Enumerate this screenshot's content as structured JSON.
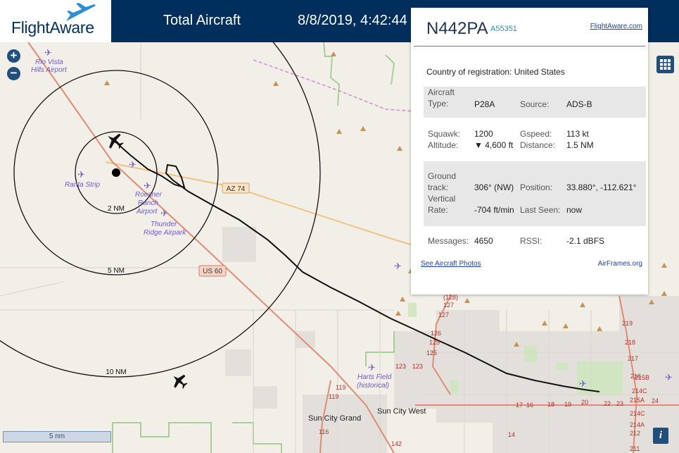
{
  "header": {
    "logo_text": "FlightAware",
    "total_label": "Total Aircraft",
    "timestamp": "8/8/2019, 4:42:44"
  },
  "map_controls": {
    "zoom_in": "+",
    "zoom_out": "−",
    "info": "i",
    "scale_label": "5 nm"
  },
  "range_rings": [
    "2 NM",
    "5 NM",
    "10 NM"
  ],
  "places": [
    "Rio Vista Hills Airport",
    "Ranta Strip",
    "Roesner Ranch Airport",
    "Thunder Ridge Airpark",
    "Harts Field (historical)",
    "Sun City West",
    "Sun City Grand"
  ],
  "roads": [
    "AZ 74",
    "US 60"
  ],
  "road_numbers": [
    "(128)",
    "127",
    "127",
    "126",
    "125",
    "125",
    "123",
    "123",
    "119",
    "119",
    "116",
    "142",
    "17",
    "16",
    "18",
    "19",
    "20",
    "22",
    "23",
    "24",
    "14",
    "219",
    "218",
    "217",
    "216",
    "215B",
    "214C",
    "215A",
    "214C",
    "214A",
    "212",
    "211"
  ],
  "panel": {
    "registration": "N442PA",
    "hex": "A55351",
    "link": "FlightAware.com",
    "country_label": "Country of registration:",
    "country_value": "United States",
    "aircraft_type_label": "Aircraft Type:",
    "aircraft_type_value": "P28A",
    "source_label": "Source:",
    "source_value": "ADS-B",
    "squawk_label": "Squawk:",
    "squawk_value": "1200",
    "gspeed_label": "Gspeed:",
    "gspeed_value": "113 kt",
    "altitude_label": "Altitude:",
    "altitude_value": "▼ 4,600 ft",
    "distance_label": "Distance:",
    "distance_value": "1.5 NM",
    "ground_track_label": "Ground track:",
    "ground_track_value": "306° (NW)",
    "position_label": "Position:",
    "position_value": "33.880°, -112.621°",
    "vertical_rate_label": "Vertical Rate:",
    "vertical_rate_value": "-704 ft/min",
    "last_seen_label": "Last Seen:",
    "last_seen_value": "now",
    "messages_label": "Messages:",
    "messages_value": "4650",
    "rssi_label": "RSSI:",
    "rssi_value": "-2.1 dBFS",
    "photos_link": "See Aircraft Photos",
    "airframes_link": "AirFrames.org"
  },
  "colors": {
    "header_bg": "#002f5d",
    "map_bg": "#f2efe9",
    "accent": "#2b8fd1",
    "airport_icon": "#7b68c8",
    "highway": "#e8b87a",
    "railway": "#d08bd0"
  }
}
